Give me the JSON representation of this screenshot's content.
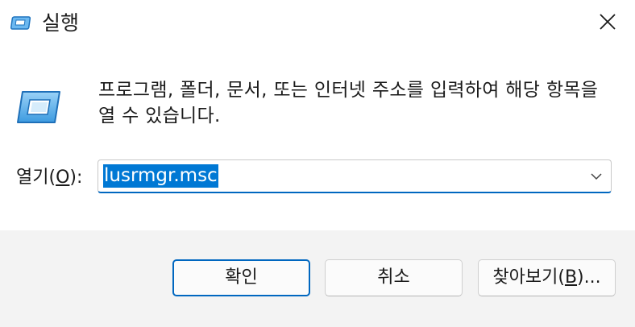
{
  "window": {
    "title": "실행",
    "icon": "run-app-icon",
    "close_icon": "close-icon"
  },
  "body": {
    "description": "프로그램, 폴더, 문서, 또는 인터넷 주소를 입력하여 해당 항목을 열 수 있습니다.",
    "icon": "run-dialog-icon",
    "open_label": {
      "prefix": "열기(",
      "accel": "O",
      "suffix": "):"
    },
    "open_field": {
      "value": "lusrmgr.msc",
      "selected": true
    }
  },
  "buttons": {
    "ok": "확인",
    "cancel": "취소",
    "browse": {
      "prefix": "찾아보기(",
      "accel": "B",
      "suffix": ")..."
    }
  },
  "colors": {
    "accent": "#0067c0",
    "selection": "#0078d4",
    "footer_bg": "#f3f3f3"
  }
}
